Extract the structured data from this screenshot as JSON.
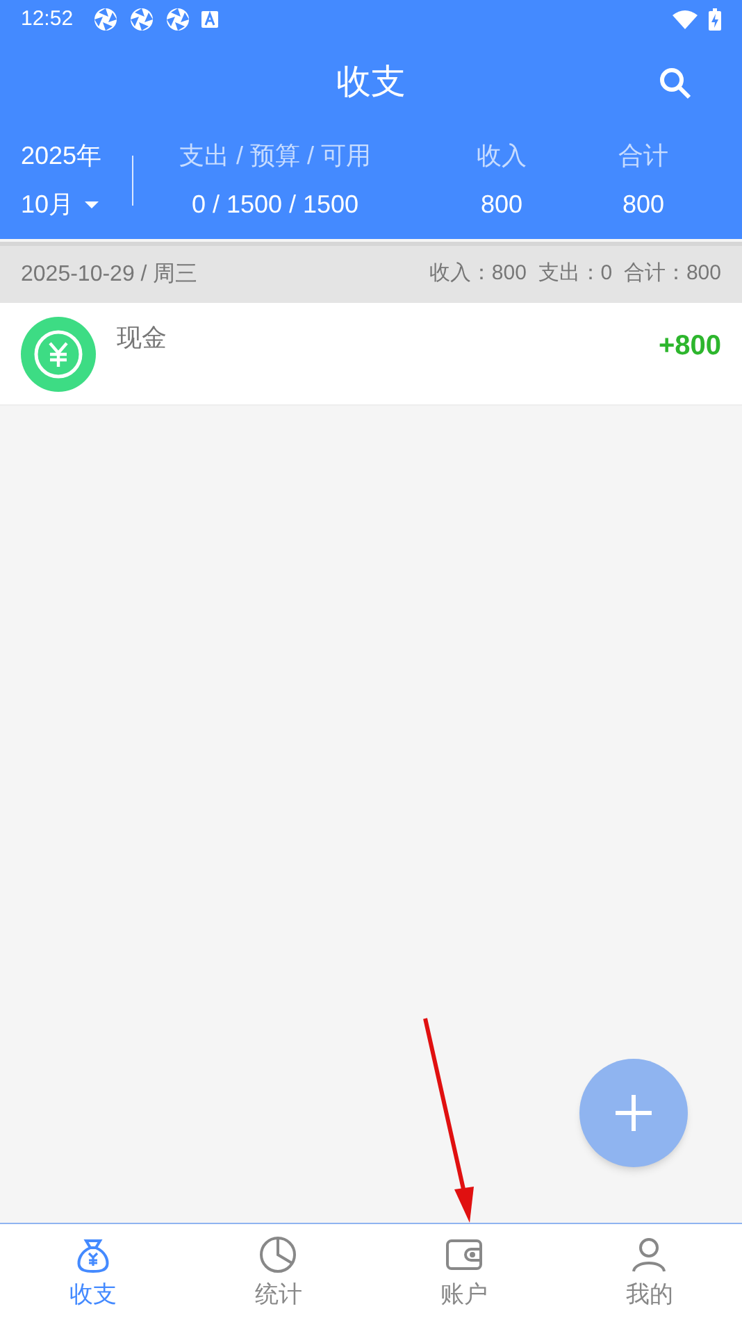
{
  "status_bar": {
    "time": "12:52"
  },
  "header": {
    "title": "收支"
  },
  "summary": {
    "year": "2025年",
    "month": "10月",
    "columns": [
      {
        "label": "支出 / 预算 / 可用",
        "value": "0 / 1500 / 1500"
      },
      {
        "label": "收入",
        "value": "800"
      },
      {
        "label": "合计",
        "value": "800"
      }
    ]
  },
  "days": [
    {
      "date": "2025-10-29 / 周三",
      "totals": "收入：800  支出：0  合计：800",
      "entries": [
        {
          "name": "现金",
          "amount": "+800",
          "kind": "income"
        }
      ]
    }
  ],
  "tabs": [
    {
      "label": "收支",
      "kind": "moneybag",
      "selected": true
    },
    {
      "label": "统计",
      "kind": "pie",
      "selected": false
    },
    {
      "label": "账户",
      "kind": "wallet",
      "selected": false
    },
    {
      "label": "我的",
      "kind": "person",
      "selected": false
    }
  ]
}
